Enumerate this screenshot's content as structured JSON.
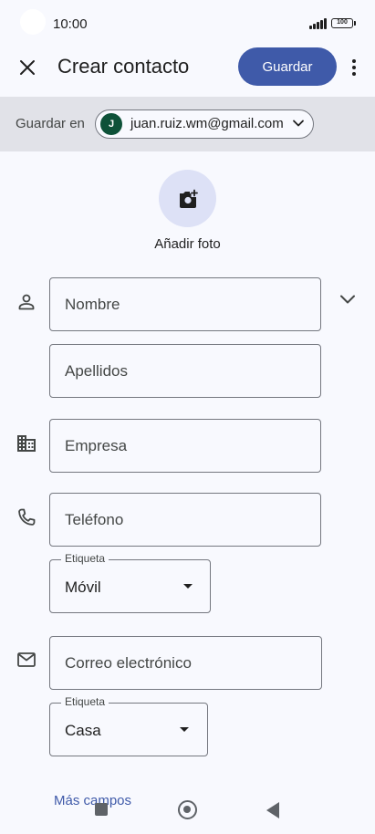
{
  "status_bar": {
    "time": "10:00",
    "battery": "100"
  },
  "app_bar": {
    "title": "Crear contacto",
    "save_label": "Guardar"
  },
  "account": {
    "save_in_label": "Guardar en",
    "avatar_letter": "J",
    "email": "juan.ruiz.wm@gmail.com"
  },
  "photo": {
    "label": "Añadir foto"
  },
  "fields": {
    "first_name_placeholder": "Nombre",
    "last_name_placeholder": "Apellidos",
    "company_placeholder": "Empresa",
    "phone_placeholder": "Teléfono",
    "phone_label_title": "Etiqueta",
    "phone_label_value": "Móvil",
    "email_placeholder": "Correo electrónico",
    "email_label_title": "Etiqueta",
    "email_label_value": "Casa"
  },
  "more_fields_label": "Más campos",
  "icons": {
    "close": "close-icon",
    "more": "more-vert-icon",
    "add_photo": "add-photo-icon",
    "person": "person-icon",
    "company": "building-icon",
    "phone": "phone-icon",
    "email": "mail-icon"
  },
  "colors": {
    "accent": "#3f5aa9",
    "avatar": "#0d5138",
    "band": "#e1e2e8",
    "photo_bg": "#dde1f6"
  }
}
